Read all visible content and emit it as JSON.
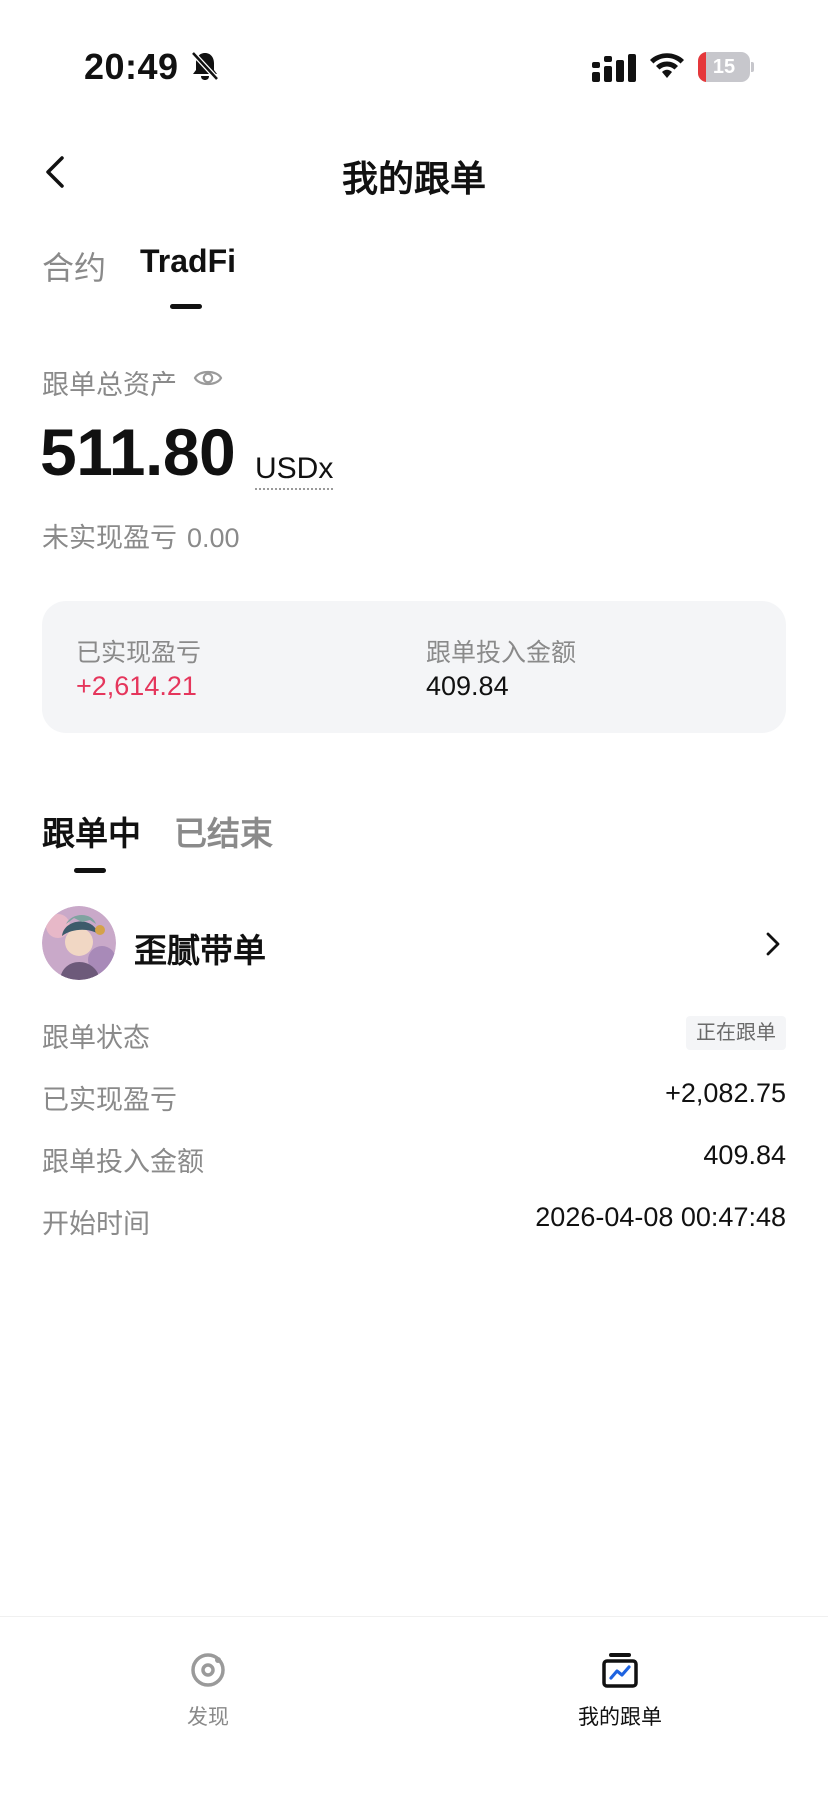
{
  "status_bar": {
    "time": "20:49",
    "battery_level": "15",
    "battery_fraction": 0.15,
    "icons": [
      "bell-off-icon",
      "signal-icon",
      "wifi-icon",
      "battery-icon"
    ]
  },
  "header": {
    "title": "我的跟单",
    "back_icon": "chevron-left-icon"
  },
  "top_tabs": [
    {
      "label": "合约",
      "active": false
    },
    {
      "label": "TradFi",
      "active": true
    }
  ],
  "assets": {
    "label": "跟单总资产",
    "value": "511.80",
    "unit": "USDx",
    "unrealized_label": "未实现盈亏",
    "unrealized_value": "0.00"
  },
  "summary": {
    "realized_label": "已实现盈亏",
    "realized_value": "+2,614.21",
    "invest_label": "跟单投入金额",
    "invest_value": "409.84"
  },
  "follow_tabs": [
    {
      "label": "跟单中",
      "active": true
    },
    {
      "label": "已结束",
      "active": false
    }
  ],
  "trader": {
    "name": "歪腻带单",
    "status_label": "跟单状态",
    "status_value": "正在跟单",
    "realized_label": "已实现盈亏",
    "realized_value": "+2,082.75",
    "invest_label": "跟单投入金额",
    "invest_value": "409.84",
    "start_label": "开始时间",
    "start_value": "2026-04-08 00:47:48"
  },
  "bottom_nav": [
    {
      "label": "发现",
      "icon": "discover-icon",
      "active": false
    },
    {
      "label": "我的跟单",
      "icon": "my-copy-trade-icon",
      "active": true
    }
  ],
  "colors": {
    "positive": "#e5365c",
    "muted": "#8a8a8a",
    "card_bg": "#f4f5f7",
    "text": "#111111"
  }
}
